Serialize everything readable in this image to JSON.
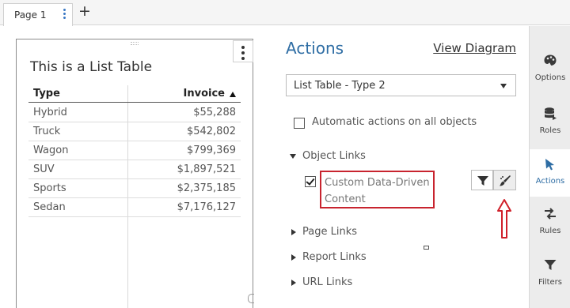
{
  "tabs": {
    "page_label": "Page 1",
    "add_label": "+"
  },
  "list_table": {
    "title": "This is a List Table",
    "columns": [
      "Type",
      "Invoice"
    ],
    "rows": [
      {
        "type": "Hybrid",
        "invoice": "$55,288"
      },
      {
        "type": "Truck",
        "invoice": "$542,802"
      },
      {
        "type": "Wagon",
        "invoice": "$799,369"
      },
      {
        "type": "SUV",
        "invoice": "$1,897,521"
      },
      {
        "type": "Sports",
        "invoice": "$2,375,185"
      },
      {
        "type": "Sedan",
        "invoice": "$7,176,127"
      }
    ],
    "sort_icon": "sort-ascending-triangle"
  },
  "actions": {
    "title": "Actions",
    "view_diagram": "View Diagram",
    "dropdown_value": "List Table - Type 2",
    "auto_actions_label": "Automatic actions on all objects",
    "auto_actions_checked": false,
    "object_links": {
      "label": "Object Links",
      "expanded": true,
      "item_label": "Custom Data-Driven Content",
      "item_checked": true
    },
    "collapsed_sections": [
      "Page Links",
      "Report Links",
      "URL Links"
    ]
  },
  "rail": {
    "items": [
      {
        "label": "Options",
        "icon": "palette-icon"
      },
      {
        "label": "Roles",
        "icon": "database-icon"
      },
      {
        "label": "Actions",
        "icon": "cursor-icon",
        "active": true
      },
      {
        "label": "Rules",
        "icon": "swap-arrows-icon"
      },
      {
        "label": "Filters",
        "icon": "funnel-icon"
      }
    ]
  },
  "colors": {
    "accent": "#2e6da4",
    "highlight_box": "#c8242f",
    "annotation_arrow": "#d0202a"
  }
}
